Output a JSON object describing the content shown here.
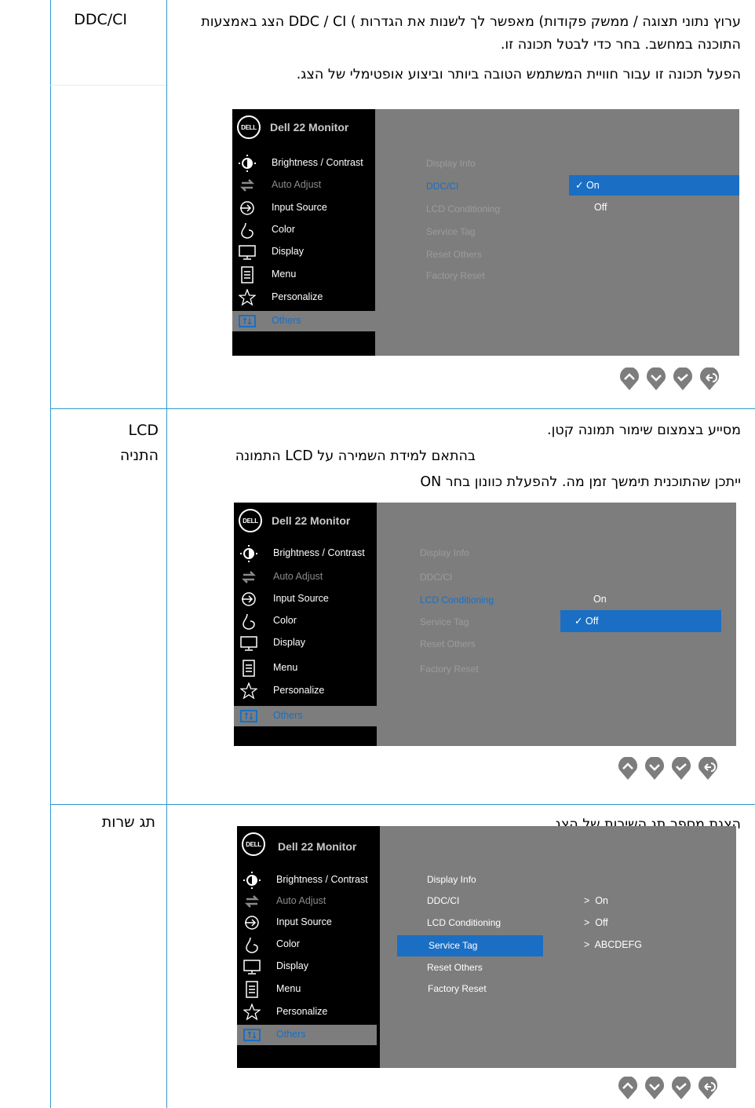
{
  "rows": [
    {
      "label": "DDC/CI",
      "paragraphs": [
        "ערוץ נתוני תצוגה / ממשק פקודות) מאפשר לך לשנות את הגדרות ) DDC / CI הצג באמצעות התוכנה במחשב. בחר כדי לבטל תכונה זו.",
        "הפעל תכונה זו עבור חוויית המשתמש הטובה ביותר וביצוע אופטימלי של הצג."
      ]
    },
    {
      "label": "LCD\nהתניה",
      "paragraphs": [
        "מסייע בצמצום שימור תמונה קטן.",
        "בהתאם למידת השמירה על LCD התמונה",
        "ייתכן שהתוכנית תימשך זמן מה. להפעלת כוונון בחר ON"
      ]
    },
    {
      "label": "תג שרות",
      "paragraphs": [
        "הצגת מספר תג השירות של הצג"
      ]
    }
  ],
  "osd": {
    "logo": "DELL",
    "title": "Dell 22 Monitor",
    "menu": [
      {
        "label": "Brightness / Contrast",
        "icon": "brightness-icon"
      },
      {
        "label": "Auto Adjust",
        "icon": "auto-adjust-icon"
      },
      {
        "label": "Input Source",
        "icon": "input-source-icon"
      },
      {
        "label": "Color",
        "icon": "color-icon"
      },
      {
        "label": "Display",
        "icon": "display-icon"
      },
      {
        "label": "Menu",
        "icon": "menu-icon"
      },
      {
        "label": "Personalize",
        "icon": "star-icon"
      },
      {
        "label": "Others",
        "icon": "others-icon"
      }
    ],
    "submenu": [
      "Display Info",
      "DDC/CI",
      "LCD Conditioning",
      "Service Tag",
      "Reset Others",
      "Factory Reset"
    ],
    "screen1": {
      "options": [
        "On",
        "Off"
      ],
      "selected_option": "On",
      "check": "✓"
    },
    "screen2": {
      "options": [
        "On",
        "Off"
      ],
      "selected_option": "Off",
      "check": "✓"
    },
    "screen3": {
      "values": [
        "On",
        "Off",
        "ABCDEFG"
      ],
      "arrow": ">"
    }
  },
  "nav_buttons": [
    "up-icon",
    "down-icon",
    "ok-icon",
    "back-icon"
  ],
  "colors": {
    "rule": "#2e9ad0",
    "osd_bg": "#7d7d7d",
    "osd_side": "#000000",
    "highlight": "#1a6fc4"
  }
}
